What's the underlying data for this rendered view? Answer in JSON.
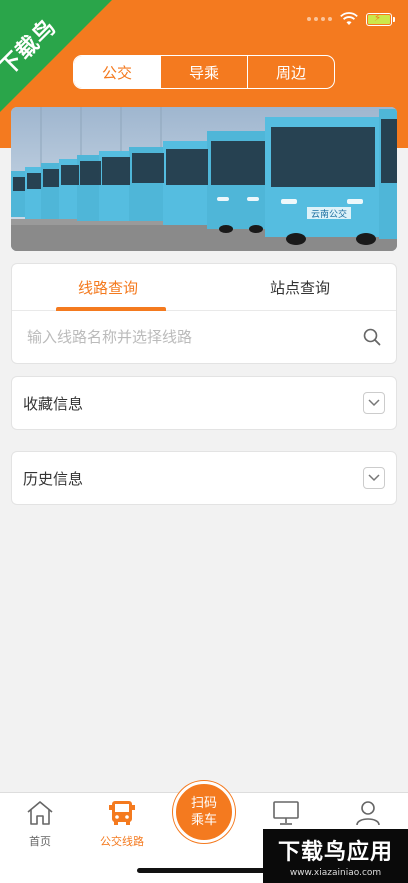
{
  "watermark": {
    "corner_text": "下载鸟",
    "bottom_text": "下载鸟应用",
    "bottom_site": "www.xiazainiao.com"
  },
  "segment": {
    "tabs": [
      "公交",
      "导乘",
      "周边"
    ],
    "active": "公交"
  },
  "banner": {
    "bus_sign": "云南公交"
  },
  "query": {
    "tabs": [
      "线路查询",
      "站点查询"
    ],
    "active_tab": "线路查询",
    "search_placeholder": "输入线路名称并选择线路"
  },
  "favorites": {
    "label": "收藏信息"
  },
  "history": {
    "label": "历史信息"
  },
  "tabbar": {
    "items": [
      {
        "label": "首页",
        "icon": "home-icon"
      },
      {
        "label": "公交线路",
        "icon": "bus-icon",
        "active": true
      },
      {
        "label": "",
        "icon": "monitor-icon"
      },
      {
        "label": "",
        "icon": "user-icon"
      }
    ],
    "scan_line1": "扫码",
    "scan_line2": "乘车"
  },
  "colors": {
    "accent": "#f47a1f",
    "background": "#f2f2f2",
    "watermark_green": "#2aa54a"
  }
}
